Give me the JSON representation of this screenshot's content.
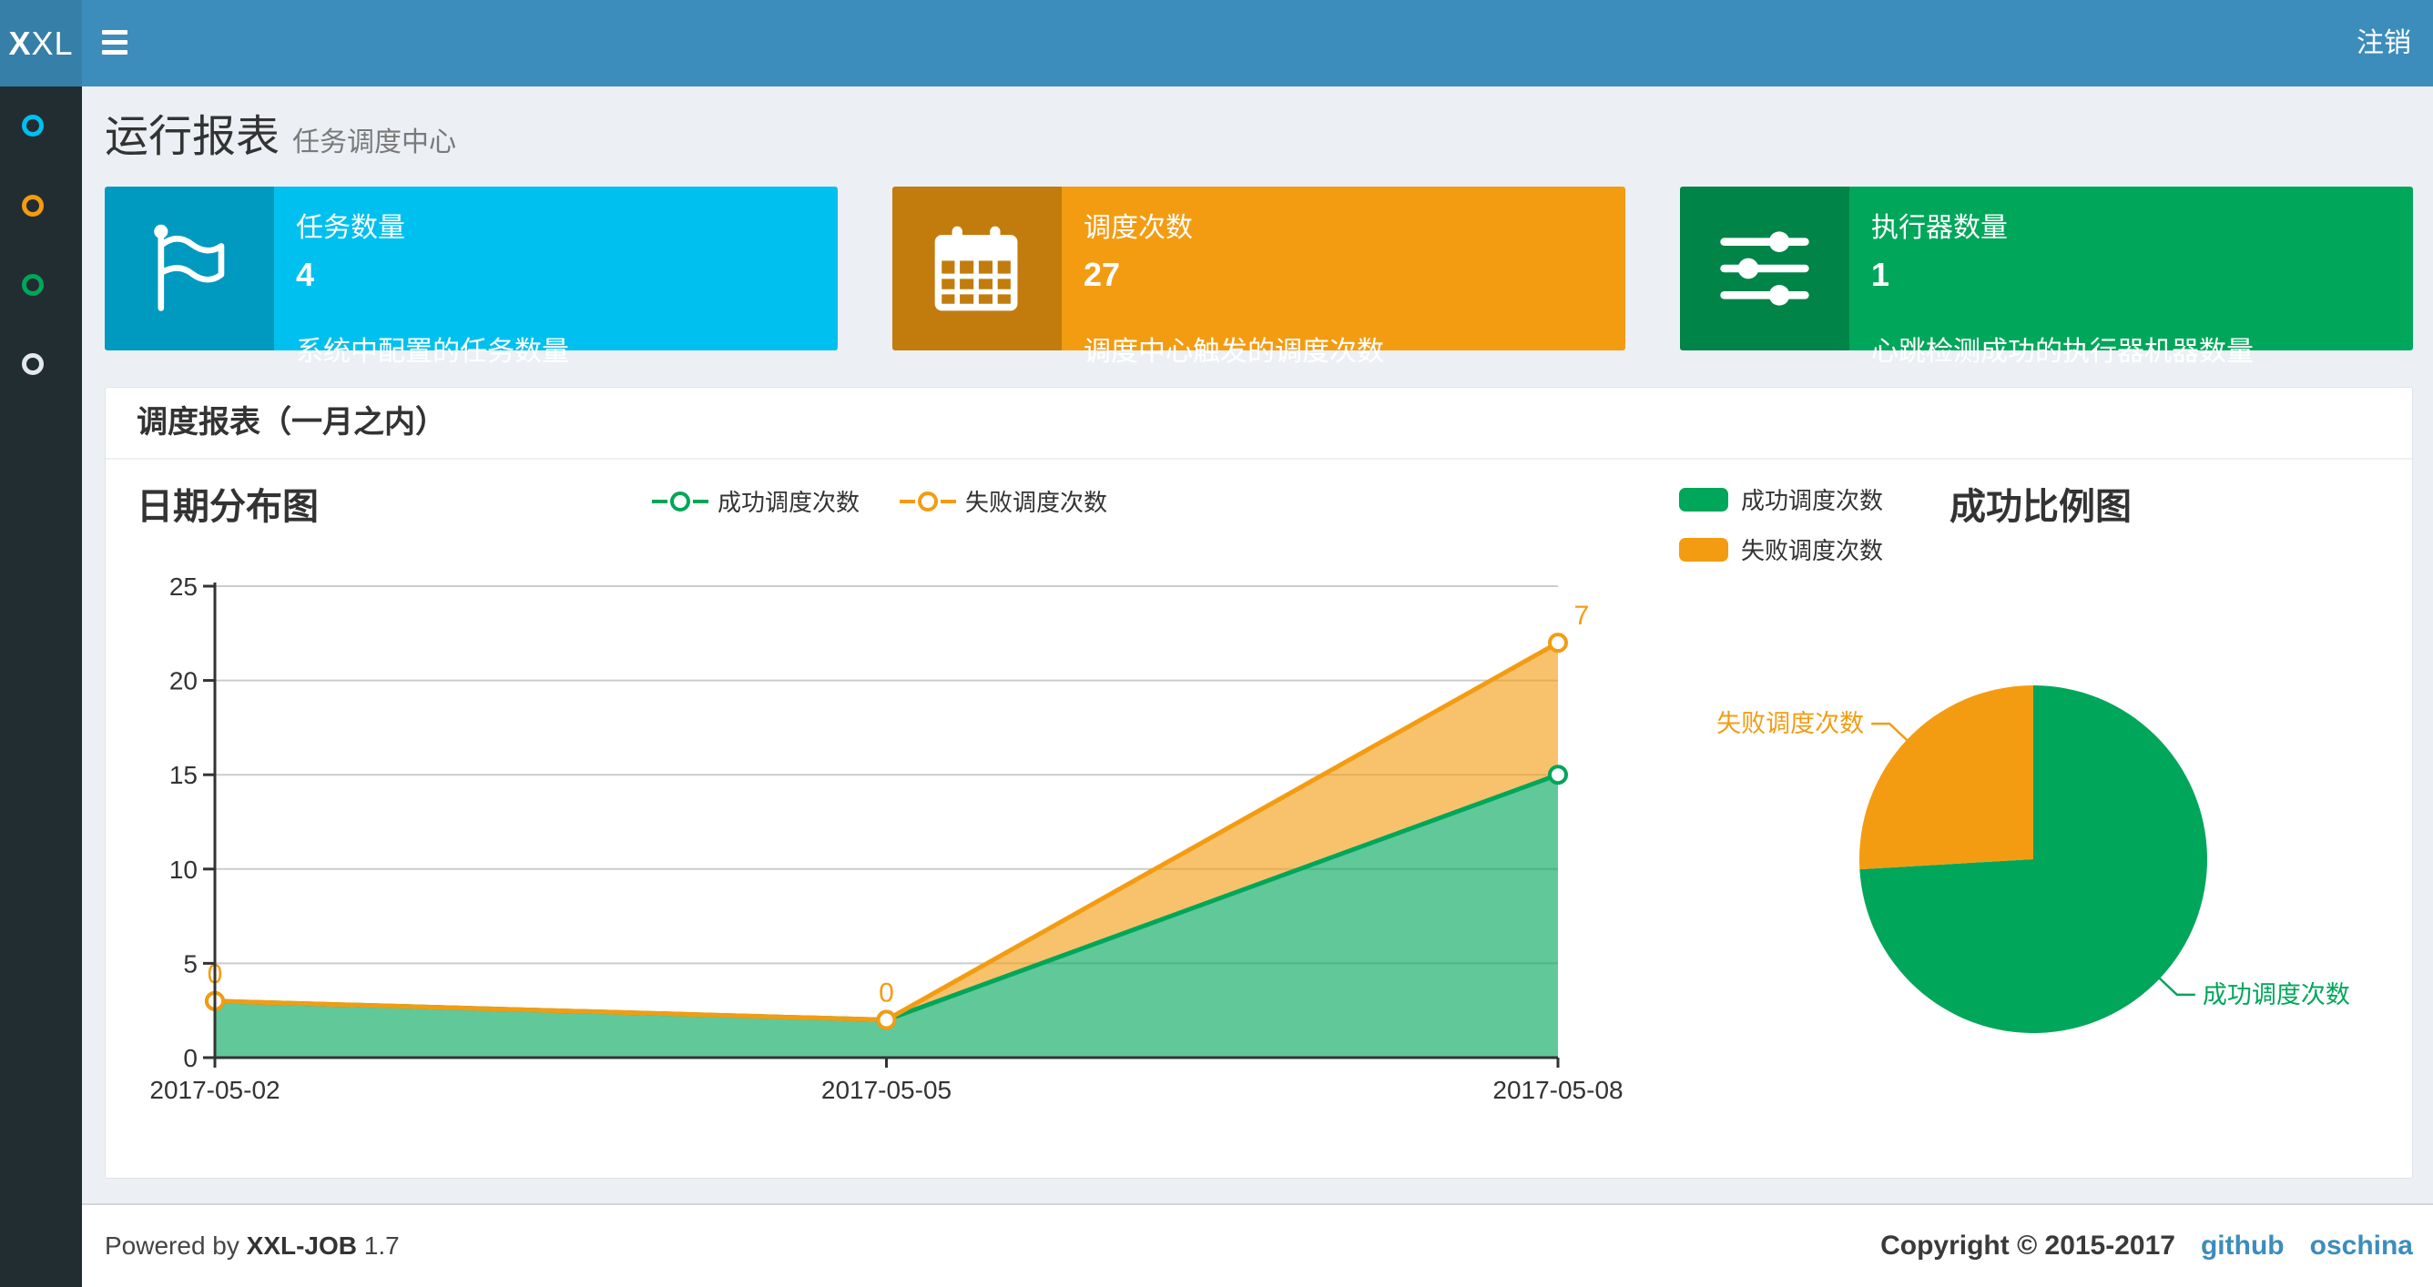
{
  "navbar": {
    "logo_bold": "X",
    "logo_rest": "XL",
    "logout_label": "注销"
  },
  "sidebar": {
    "items": [
      {
        "name": "menu-item-1",
        "color": "#00c0ef"
      },
      {
        "name": "menu-item-2",
        "color": "#f39c12"
      },
      {
        "name": "menu-item-3",
        "color": "#00a65a"
      },
      {
        "name": "menu-item-4",
        "color": "#e4e9ec"
      }
    ]
  },
  "page_header": {
    "title": "运行报表",
    "subtitle": "任务调度中心"
  },
  "stat_boxes": [
    {
      "label": "任务数量",
      "value": "4",
      "description": "系统中配置的任务数量",
      "color": "#00c0ef",
      "icon": "flag-icon"
    },
    {
      "label": "调度次数",
      "value": "27",
      "description": "调度中心触发的调度次数",
      "color": "#f39c12",
      "icon": "calendar-icon"
    },
    {
      "label": "执行器数量",
      "value": "1",
      "description": "心跳检测成功的执行器机器数量",
      "color": "#00a65a",
      "icon": "sliders-icon"
    }
  ],
  "panel": {
    "title": "调度报表（一月之内）"
  },
  "chart_data": [
    {
      "type": "area",
      "title": "日期分布图",
      "x": [
        "2017-05-02",
        "2017-05-05",
        "2017-05-08"
      ],
      "series": [
        {
          "name": "成功调度次数",
          "color": "#00a65a",
          "values": [
            3,
            2,
            15
          ]
        },
        {
          "name": "失败调度次数",
          "color": "#f39c12",
          "values": [
            0,
            0,
            7
          ]
        }
      ],
      "stacked": true,
      "point_labels_series": "失败调度次数",
      "point_labels": [
        0,
        0,
        7
      ],
      "xlabel": "",
      "ylabel": "",
      "ylim": [
        0,
        25
      ],
      "yticks": [
        0,
        5,
        10,
        15,
        20,
        25
      ],
      "grid": true,
      "legend_position": "top"
    },
    {
      "type": "pie",
      "title": "成功比例图",
      "slices": [
        {
          "name": "成功调度次数",
          "value": 20,
          "color": "#00a65a"
        },
        {
          "name": "失败调度次数",
          "value": 7,
          "color": "#f39c12"
        }
      ],
      "legend_position": "top-left"
    }
  ],
  "footer": {
    "powered_prefix": "Powered by",
    "product": "XXL-JOB",
    "version": "1.7",
    "copyright": "Copyright © 2015-2017",
    "links": [
      {
        "label": "github"
      },
      {
        "label": "oschina"
      }
    ],
    "link_color": "#3c8dbc"
  }
}
